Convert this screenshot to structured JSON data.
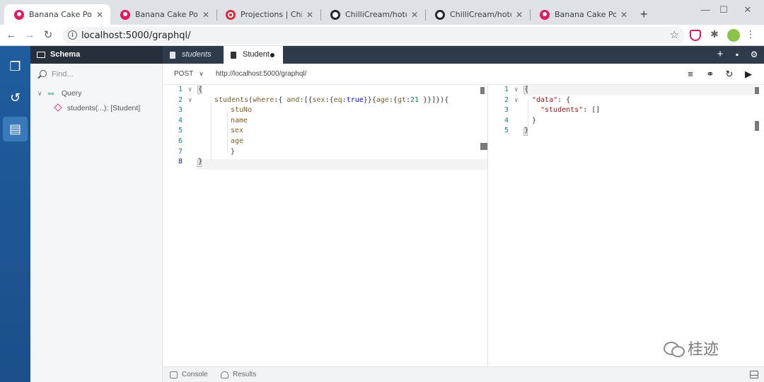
{
  "browser": {
    "tabs": [
      {
        "title": "Banana Cake Pop > ",
        "favicon": "banana-cake-pop-icon"
      },
      {
        "title": "Banana Cake Pop > ",
        "favicon": "banana-cake-pop-icon"
      },
      {
        "title": "Projections | ChilliCr",
        "favicon": "chillicream-icon"
      },
      {
        "title": "ChilliCream/hotchoc",
        "favicon": "github-icon"
      },
      {
        "title": "ChilliCream/hotchoc",
        "favicon": "github-icon"
      },
      {
        "title": "Banana Cake Pop > ",
        "favicon": "banana-cake-pop-icon"
      }
    ],
    "close_glyph": "✕",
    "new_tab_glyph": "+",
    "window_controls": {
      "minimize": "—",
      "maximize": "☐",
      "close": "✕"
    },
    "nav": {
      "back": "←",
      "forward": "→",
      "reload": "↻"
    },
    "url": "localhost:5000/graphql/",
    "info_glyph": "i",
    "star_glyph": "☆",
    "extensions": {
      "puzzle": "✱",
      "menu": "⋮"
    }
  },
  "app": {
    "rail": {
      "items": [
        {
          "name": "documents-icon",
          "glyph": "❐"
        },
        {
          "name": "history-icon",
          "glyph": "↺"
        },
        {
          "name": "schema-book-icon",
          "glyph": "▤"
        }
      ]
    },
    "sidebar": {
      "title": "Schema",
      "find_placeholder": "Find...",
      "tree": {
        "root": "Query",
        "child": "students(...): [Student]"
      }
    },
    "doc_tabs": [
      {
        "label": "students",
        "active": false
      },
      {
        "label": "Student",
        "active": true,
        "unsaved": true
      }
    ],
    "strip_actions": {
      "add": "+",
      "save": "▪",
      "settings": "⚙"
    },
    "request": {
      "method": "POST",
      "caret": "∨",
      "endpoint": "http://localhost:5000/graphql/",
      "actions": {
        "variables": "≡",
        "link": "⚭",
        "refresh": "↻",
        "run": "▶"
      }
    },
    "editor": {
      "lines": [
        "1",
        "2",
        "3",
        "4",
        "5",
        "6",
        "7",
        "8"
      ],
      "code": {
        "l1": "{",
        "l2_fn": "students",
        "l2_a": "(",
        "l2_where": "where",
        "l2_b": ":{ ",
        "l2_and": "and",
        "l2_c": ":[{",
        "l2_sex": "sex",
        "l2_d": ":{",
        "l2_eq": "eq",
        "l2_e": ":",
        "l2_true": "true",
        "l2_f": "}}{",
        "l2_age": "age",
        "l2_g": ":{",
        "l2_gt": "gt",
        "l2_h": ":",
        "l2_21": "21",
        "l2_i": " }}]}){",
        "l3": "stuNo",
        "l4": "name",
        "l5": "sex",
        "l6": "age",
        "l7": "}",
        "l8": "}"
      }
    },
    "result": {
      "lines": [
        "1",
        "2",
        "3",
        "4",
        "5"
      ],
      "code": {
        "l1": "{",
        "l2_key": "\"data\"",
        "l2_rest": ": {",
        "l3_key": "\"students\"",
        "l3_rest": ": []",
        "l4": "}",
        "l5": "}"
      }
    },
    "footer": {
      "console": "Console",
      "results": "Results"
    }
  },
  "watermark": "桂迹",
  "colors": {
    "rail": "#1f5d9e",
    "strip": "#2e3b4a",
    "brand_pink": "#e8175d",
    "line_number": "#237893"
  }
}
